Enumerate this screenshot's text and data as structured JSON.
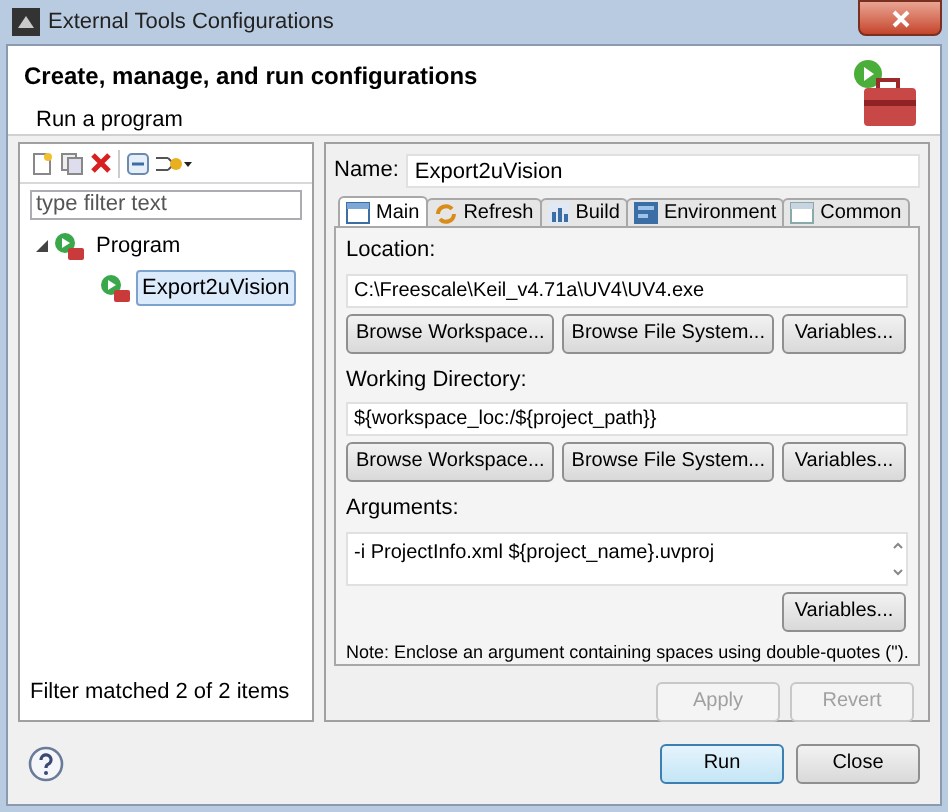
{
  "window": {
    "title": "External Tools Configurations"
  },
  "header": {
    "title": "Create, manage, and run configurations",
    "subtitle": "Run a program"
  },
  "filter": {
    "placeholder": "type filter text"
  },
  "tree": [
    {
      "label": "Program",
      "expanded": true,
      "selected": false,
      "children": [
        {
          "label": "Export2uVision",
          "selected": true
        }
      ]
    }
  ],
  "filter_status": "Filter matched 2 of 2 items",
  "name": {
    "label": "Name:",
    "value": "Export2uVision"
  },
  "tabs": [
    {
      "label": "Main",
      "selected": true
    },
    {
      "label": "Refresh",
      "selected": false
    },
    {
      "label": "Build",
      "selected": false
    },
    {
      "label": "Environment",
      "selected": false
    },
    {
      "label": "Common",
      "selected": false
    }
  ],
  "groups": [
    {
      "kind": "single",
      "label": "Location:",
      "value": "C:\\Freescale\\Keil_v4.71a\\UV4\\UV4.exe",
      "buttons": [
        "Browse Workspace...",
        "Browse File System...",
        "Variables..."
      ]
    },
    {
      "kind": "single",
      "label": "Working Directory:",
      "value": "${workspace_loc:/${project_path}}",
      "buttons": [
        "Browse Workspace...",
        "Browse File System...",
        "Variables..."
      ]
    },
    {
      "kind": "multiline",
      "label": "Arguments:",
      "value": "-i ProjectInfo.xml ${project_name}.uvproj",
      "buttons": [
        "Variables..."
      ],
      "note": "Note: Enclose an argument containing spaces using double-quotes (\")."
    }
  ],
  "actions": [
    {
      "label": "Apply",
      "disabled": true
    },
    {
      "label": "Revert",
      "disabled": true
    }
  ],
  "dialog_buttons": [
    {
      "label": "Run",
      "default": true
    },
    {
      "label": "Close",
      "default": false
    }
  ]
}
